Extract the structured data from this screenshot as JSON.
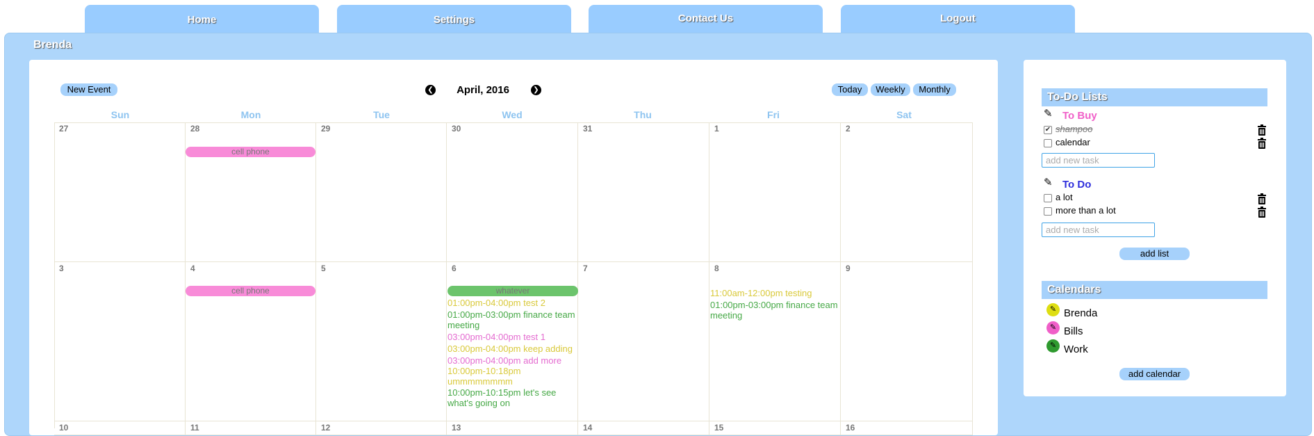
{
  "nav": {
    "items": [
      {
        "label": "Home"
      },
      {
        "label": "Settings"
      },
      {
        "label": "Contact Us"
      },
      {
        "label": "Logout"
      }
    ]
  },
  "user": {
    "name": "Brenda"
  },
  "calendar": {
    "new_event_label": "New Event",
    "month_title": "April, 2016",
    "view_buttons": {
      "today": "Today",
      "weekly": "Weekly",
      "monthly": "Monthly"
    },
    "weekdays": [
      "Sun",
      "Mon",
      "Tue",
      "Wed",
      "Thu",
      "Fri",
      "Sat"
    ],
    "weeks": [
      [
        "27",
        "28",
        "29",
        "30",
        "31",
        "1",
        "2"
      ],
      [
        "3",
        "4",
        "5",
        "6",
        "7",
        "8",
        "9"
      ],
      [
        "10",
        "11",
        "12",
        "13",
        "14",
        "15",
        "16"
      ]
    ],
    "events": {
      "w1_mon_pill": "cell phone",
      "w2_mon_pill": "cell phone",
      "w2_wed_pill": "whatever",
      "w2_wed": [
        "01:00pm-04:00pm test 2",
        "01:00pm-03:00pm finance team meeting",
        "03:00pm-04:00pm test 1",
        "03:00pm-04:00pm keep adding",
        "03:00pm-04:00pm add more",
        "10:00pm-10:18pm ummmmmmmm",
        "10:00pm-10:15pm let's see what's going on"
      ],
      "w2_fri": [
        "11:00am-12:00pm testing",
        "01:00pm-03:00pm finance team meeting"
      ]
    },
    "colors": {
      "pink": "#f88bd8",
      "green": "#6cc46c",
      "yellow": "#d9c93a"
    }
  },
  "todo": {
    "header": "To-Do Lists",
    "lists": [
      {
        "title": "To Buy",
        "color": "#f05fc8",
        "tasks": [
          {
            "text": "shampoo",
            "done": true
          },
          {
            "text": "calendar",
            "done": false
          }
        ],
        "input_placeholder": "add new task"
      },
      {
        "title": "To Do",
        "color": "#2f2fdc",
        "tasks": [
          {
            "text": "a lot",
            "done": false
          },
          {
            "text": "more than a lot",
            "done": false
          }
        ],
        "input_placeholder": "add new task"
      }
    ],
    "add_list_label": "add list"
  },
  "calendars": {
    "header": "Calendars",
    "items": [
      {
        "name": "Brenda",
        "color": "#dede12"
      },
      {
        "name": "Bills",
        "color": "#f05fc8"
      },
      {
        "name": "Work",
        "color": "#2f9a2f"
      }
    ],
    "add_calendar_label": "add calendar"
  }
}
